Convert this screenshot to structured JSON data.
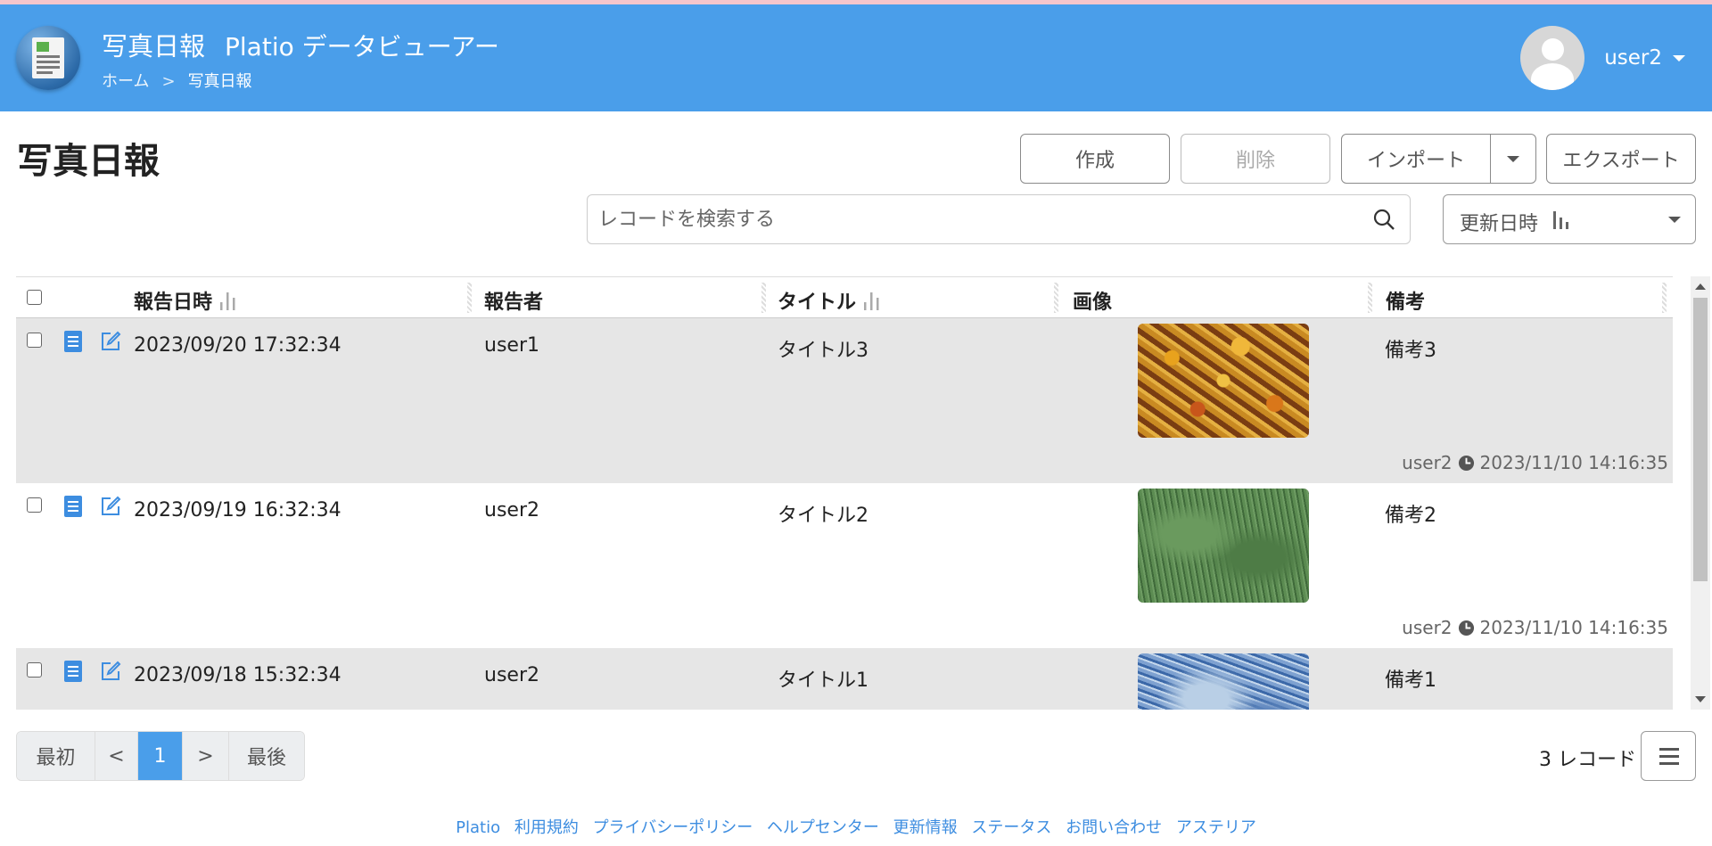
{
  "header": {
    "app_name": "写真日報",
    "app_subtitle": "Platio データビューアー",
    "breadcrumb": {
      "home": "ホーム",
      "separator": ">",
      "current": "写真日報"
    },
    "user": {
      "name": "user2"
    },
    "background_color": "#4a9eea"
  },
  "main": {
    "title": "写真日報",
    "toolbar": {
      "create_label": "作成",
      "delete_label": "削除",
      "import_label": "インポート",
      "export_label": "エクスポート"
    },
    "search": {
      "placeholder": "レコードを検索する",
      "value": ""
    },
    "sort": {
      "selected": "更新日時"
    }
  },
  "table": {
    "columns": [
      "報告日時",
      "報告者",
      "タイトル",
      "画像",
      "備考"
    ],
    "rows": [
      {
        "date": "2023/09/20 17:32:34",
        "reporter": "user1",
        "title": "タイトル3",
        "image": "leaves-image",
        "note": "備考3",
        "updated_by": "user2",
        "updated_at": "2023/11/10 14:16:35"
      },
      {
        "date": "2023/09/19 16:32:34",
        "reporter": "user2",
        "title": "タイトル2",
        "image": "grass-image",
        "note": "備考2",
        "updated_by": "user2",
        "updated_at": "2023/11/10 14:16:35"
      },
      {
        "date": "2023/09/18 15:32:34",
        "reporter": "user2",
        "title": "タイトル1",
        "image": "ice-image",
        "note": "備考1",
        "updated_by": "",
        "updated_at": ""
      }
    ]
  },
  "pagination": {
    "first_label": "最初",
    "prev_label": "<",
    "current_page": "1",
    "next_label": ">",
    "last_label": "最後",
    "record_count": "3 レコード"
  },
  "footer": {
    "links": [
      "Platio",
      "利用規約",
      "プライバシーポリシー",
      "ヘルプセンター",
      "更新情報",
      "ステータス",
      "お問い合わせ",
      "アステリア"
    ]
  }
}
